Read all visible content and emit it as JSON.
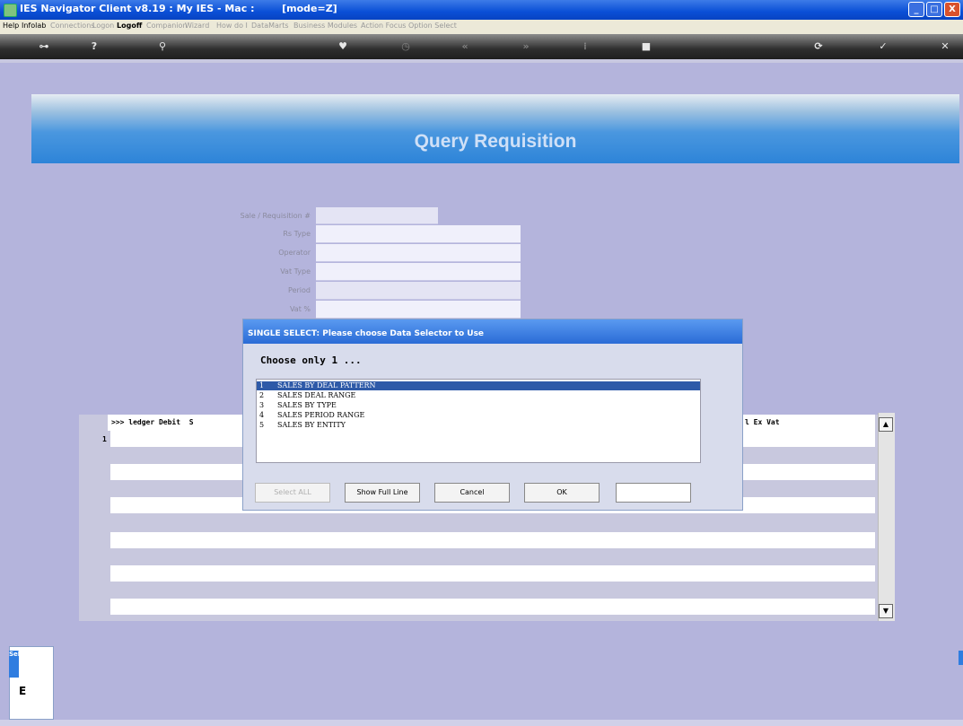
{
  "window": {
    "title": "IES Navigator Client v8.19 : My IES - Mac :        [mode=Z]",
    "min": "_",
    "max": "□",
    "close": "X"
  },
  "menu": [
    {
      "label": "Help",
      "state": "on"
    },
    {
      "label": "Infolab",
      "state": "on"
    },
    {
      "label": "Connections",
      "state": "off"
    },
    {
      "label": "Logon",
      "state": "off"
    },
    {
      "label": "Logoff",
      "state": "bold"
    },
    {
      "label": "Companion",
      "state": "off"
    },
    {
      "label": "Wizard",
      "state": "off"
    },
    {
      "label": "How do I",
      "state": "off"
    },
    {
      "label": "DataMarts",
      "state": "off"
    },
    {
      "label": "Business Modules",
      "state": "off"
    },
    {
      "label": "Action Focus",
      "state": "off"
    },
    {
      "label": "Option Select",
      "state": "off"
    }
  ],
  "toolbar": {
    "key": "⊶",
    "help": "?",
    "search": "⚲",
    "heart": "♥",
    "clock": "◷",
    "rewind": "«",
    "forward": "»",
    "bars": "⁞",
    "stop": "■",
    "refresh": "⟳",
    "ok": "✓",
    "cancel": "✕"
  },
  "page": {
    "title": "Query Requisition"
  },
  "form": {
    "sale_label": "Sale / Requisition #",
    "rs_type_label": "Rs Type",
    "operator_label": "Operator",
    "vat_type_label": "Vat Type",
    "period_label": "Period",
    "vat_pct_label": "Vat %"
  },
  "grid": {
    "col1": ">>> ledger Debit  S",
    "col2": "l Ex Vat",
    "row1": "1",
    "scroll_up": "▲",
    "scroll_down": "▼"
  },
  "dialog": {
    "title": "SINGLE SELECT: Please choose Data Selector to Use",
    "subtitle": "Choose only 1 ...",
    "options": [
      {
        "num": "1",
        "label": "SALES BY DEAL PATTERN"
      },
      {
        "num": "2",
        "label": "SALES DEAL RANGE"
      },
      {
        "num": "3",
        "label": "SALES BY TYPE"
      },
      {
        "num": "4",
        "label": "SALES PERIOD RANGE"
      },
      {
        "num": "5",
        "label": "SALES BY ENTITY"
      }
    ],
    "select_all": "Select ALL",
    "show_full": "Show Full Line",
    "cancel": "Cancel",
    "ok": "OK"
  },
  "bottom": {
    "tab": "Sel",
    "char": "E"
  }
}
